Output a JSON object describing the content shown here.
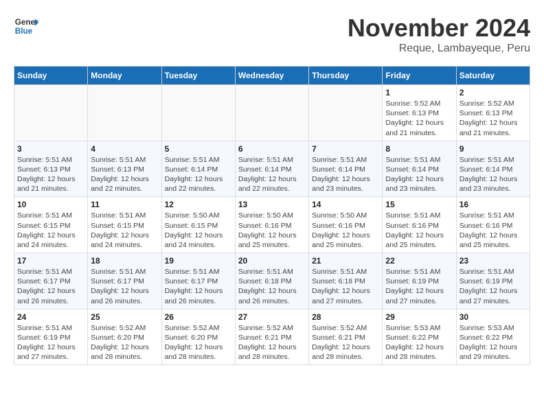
{
  "header": {
    "logo_general": "General",
    "logo_blue": "Blue",
    "month_title": "November 2024",
    "location": "Reque, Lambayeque, Peru"
  },
  "weekdays": [
    "Sunday",
    "Monday",
    "Tuesday",
    "Wednesday",
    "Thursday",
    "Friday",
    "Saturday"
  ],
  "weeks": [
    [
      {
        "day": "",
        "info": ""
      },
      {
        "day": "",
        "info": ""
      },
      {
        "day": "",
        "info": ""
      },
      {
        "day": "",
        "info": ""
      },
      {
        "day": "",
        "info": ""
      },
      {
        "day": "1",
        "info": "Sunrise: 5:52 AM\nSunset: 6:13 PM\nDaylight: 12 hours and 21 minutes."
      },
      {
        "day": "2",
        "info": "Sunrise: 5:52 AM\nSunset: 6:13 PM\nDaylight: 12 hours and 21 minutes."
      }
    ],
    [
      {
        "day": "3",
        "info": "Sunrise: 5:51 AM\nSunset: 6:13 PM\nDaylight: 12 hours and 21 minutes."
      },
      {
        "day": "4",
        "info": "Sunrise: 5:51 AM\nSunset: 6:13 PM\nDaylight: 12 hours and 22 minutes."
      },
      {
        "day": "5",
        "info": "Sunrise: 5:51 AM\nSunset: 6:14 PM\nDaylight: 12 hours and 22 minutes."
      },
      {
        "day": "6",
        "info": "Sunrise: 5:51 AM\nSunset: 6:14 PM\nDaylight: 12 hours and 22 minutes."
      },
      {
        "day": "7",
        "info": "Sunrise: 5:51 AM\nSunset: 6:14 PM\nDaylight: 12 hours and 23 minutes."
      },
      {
        "day": "8",
        "info": "Sunrise: 5:51 AM\nSunset: 6:14 PM\nDaylight: 12 hours and 23 minutes."
      },
      {
        "day": "9",
        "info": "Sunrise: 5:51 AM\nSunset: 6:14 PM\nDaylight: 12 hours and 23 minutes."
      }
    ],
    [
      {
        "day": "10",
        "info": "Sunrise: 5:51 AM\nSunset: 6:15 PM\nDaylight: 12 hours and 24 minutes."
      },
      {
        "day": "11",
        "info": "Sunrise: 5:51 AM\nSunset: 6:15 PM\nDaylight: 12 hours and 24 minutes."
      },
      {
        "day": "12",
        "info": "Sunrise: 5:50 AM\nSunset: 6:15 PM\nDaylight: 12 hours and 24 minutes."
      },
      {
        "day": "13",
        "info": "Sunrise: 5:50 AM\nSunset: 6:16 PM\nDaylight: 12 hours and 25 minutes."
      },
      {
        "day": "14",
        "info": "Sunrise: 5:50 AM\nSunset: 6:16 PM\nDaylight: 12 hours and 25 minutes."
      },
      {
        "day": "15",
        "info": "Sunrise: 5:51 AM\nSunset: 6:16 PM\nDaylight: 12 hours and 25 minutes."
      },
      {
        "day": "16",
        "info": "Sunrise: 5:51 AM\nSunset: 6:16 PM\nDaylight: 12 hours and 25 minutes."
      }
    ],
    [
      {
        "day": "17",
        "info": "Sunrise: 5:51 AM\nSunset: 6:17 PM\nDaylight: 12 hours and 26 minutes."
      },
      {
        "day": "18",
        "info": "Sunrise: 5:51 AM\nSunset: 6:17 PM\nDaylight: 12 hours and 26 minutes."
      },
      {
        "day": "19",
        "info": "Sunrise: 5:51 AM\nSunset: 6:17 PM\nDaylight: 12 hours and 26 minutes."
      },
      {
        "day": "20",
        "info": "Sunrise: 5:51 AM\nSunset: 6:18 PM\nDaylight: 12 hours and 26 minutes."
      },
      {
        "day": "21",
        "info": "Sunrise: 5:51 AM\nSunset: 6:18 PM\nDaylight: 12 hours and 27 minutes."
      },
      {
        "day": "22",
        "info": "Sunrise: 5:51 AM\nSunset: 6:19 PM\nDaylight: 12 hours and 27 minutes."
      },
      {
        "day": "23",
        "info": "Sunrise: 5:51 AM\nSunset: 6:19 PM\nDaylight: 12 hours and 27 minutes."
      }
    ],
    [
      {
        "day": "24",
        "info": "Sunrise: 5:51 AM\nSunset: 6:19 PM\nDaylight: 12 hours and 27 minutes."
      },
      {
        "day": "25",
        "info": "Sunrise: 5:52 AM\nSunset: 6:20 PM\nDaylight: 12 hours and 28 minutes."
      },
      {
        "day": "26",
        "info": "Sunrise: 5:52 AM\nSunset: 6:20 PM\nDaylight: 12 hours and 28 minutes."
      },
      {
        "day": "27",
        "info": "Sunrise: 5:52 AM\nSunset: 6:21 PM\nDaylight: 12 hours and 28 minutes."
      },
      {
        "day": "28",
        "info": "Sunrise: 5:52 AM\nSunset: 6:21 PM\nDaylight: 12 hours and 28 minutes."
      },
      {
        "day": "29",
        "info": "Sunrise: 5:53 AM\nSunset: 6:22 PM\nDaylight: 12 hours and 28 minutes."
      },
      {
        "day": "30",
        "info": "Sunrise: 5:53 AM\nSunset: 6:22 PM\nDaylight: 12 hours and 29 minutes."
      }
    ]
  ]
}
